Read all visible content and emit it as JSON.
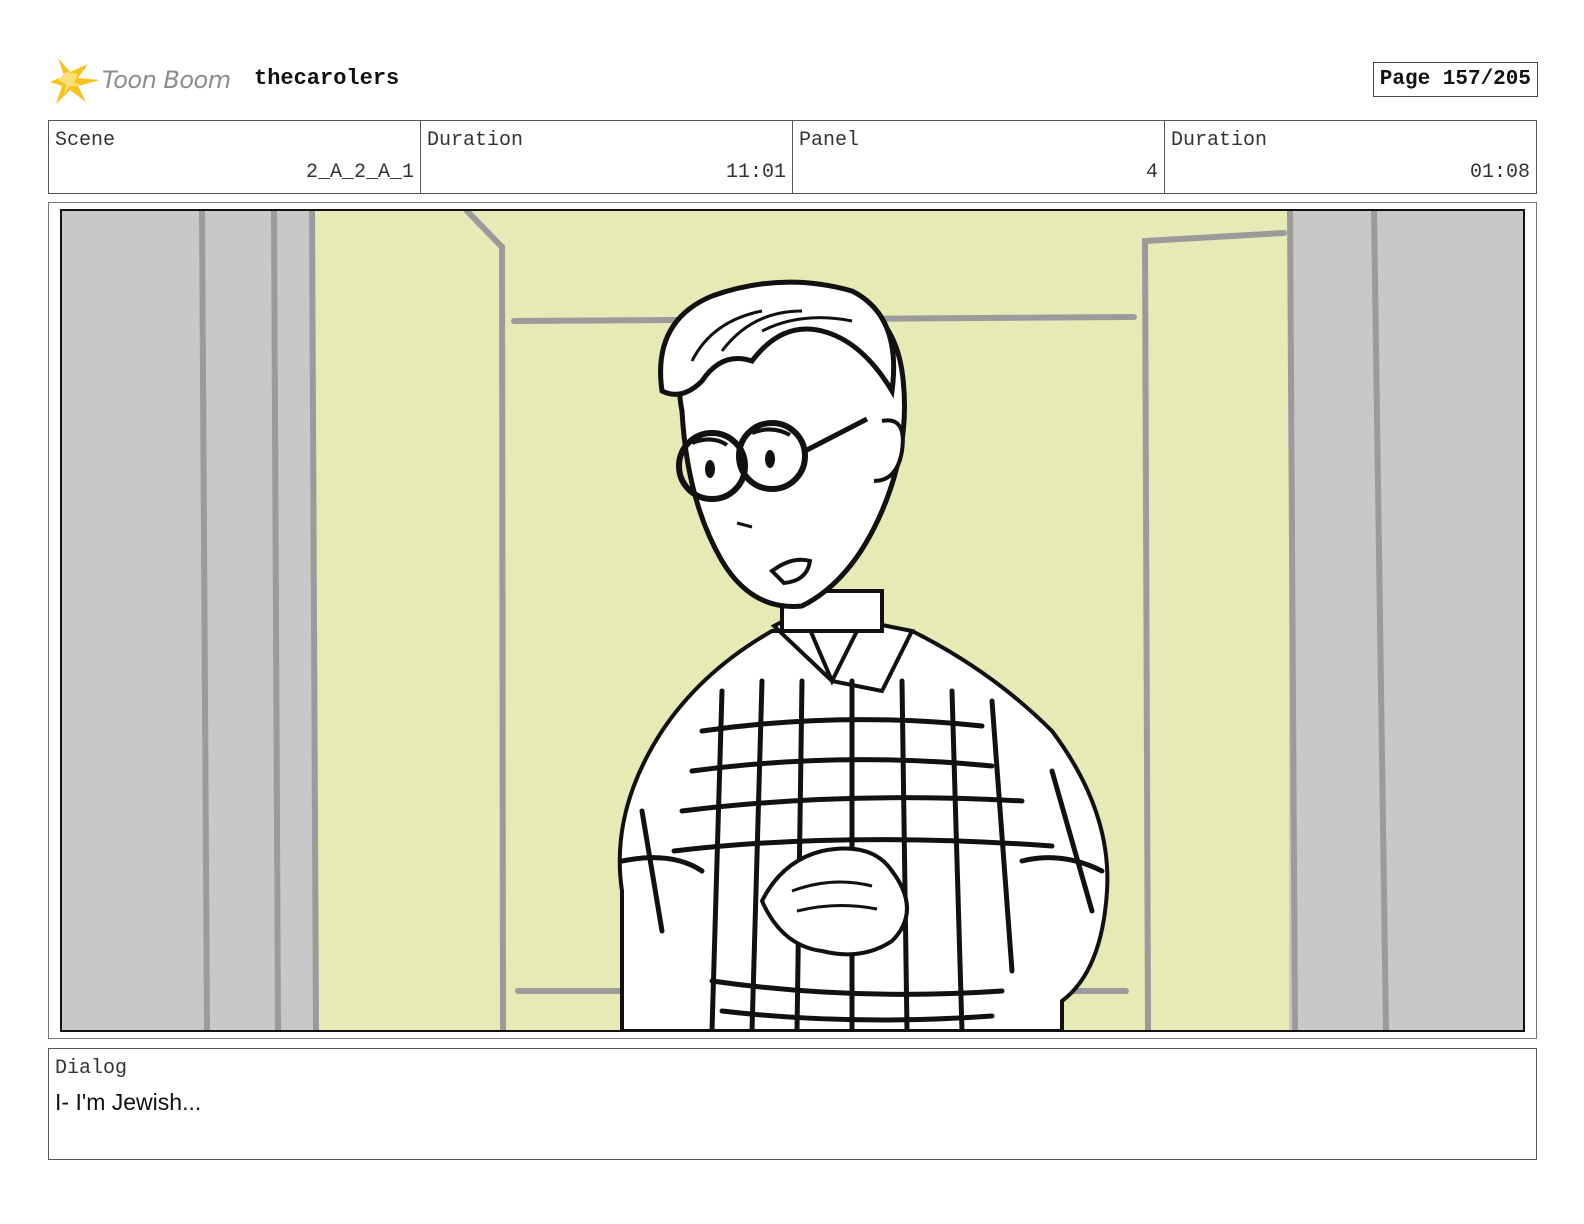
{
  "header": {
    "logo_text": "Toon Boom",
    "project": "thecarolers",
    "page": "Page 157/205"
  },
  "info": {
    "scene_label": "Scene",
    "scene_value": "2_A_2_A_1",
    "duration_label": "Duration",
    "duration_value": "11:01",
    "panel_label": "Panel",
    "panel_value": "4",
    "panel_duration_label": "Duration",
    "panel_duration_value": "01:08"
  },
  "panel": {
    "icon": "storyboard-sketch-character-with-glasses",
    "colors": {
      "wall": "#e7eab4",
      "side_panels": "#c8c8c8",
      "frame_lines": "#9b9b9b"
    }
  },
  "dialog": {
    "label": "Dialog",
    "text": "I- I'm Jewish..."
  },
  "colors": {
    "logo_accent": "#f7c21a",
    "logo_text": "#8c8c8c"
  }
}
